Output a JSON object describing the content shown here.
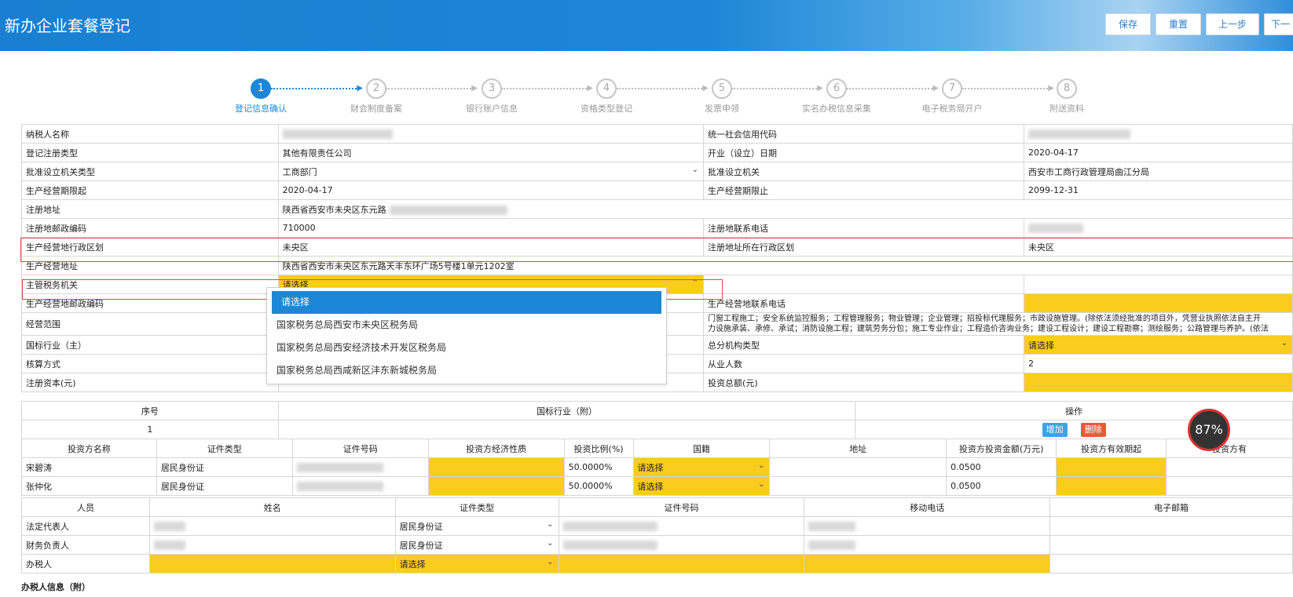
{
  "header": {
    "title": "新办企业套餐登记",
    "buttons": [
      "保存",
      "重置",
      "上一步",
      "下一"
    ]
  },
  "steps": [
    {
      "num": "1",
      "label": "登记信息确认"
    },
    {
      "num": "2",
      "label": "财会制度备案"
    },
    {
      "num": "3",
      "label": "银行账户信息"
    },
    {
      "num": "4",
      "label": "资格类型登记"
    },
    {
      "num": "5",
      "label": "发票申领"
    },
    {
      "num": "6",
      "label": "实名办税信息采集"
    },
    {
      "num": "7",
      "label": "电子税务局开户"
    },
    {
      "num": "8",
      "label": "附送资料"
    }
  ],
  "form": {
    "taxpayer_name": "纳税人名称",
    "credit_code": "统一社会信用代码",
    "reg_type": "登记注册类型",
    "reg_type_val": "其他有限责任公司",
    "open_date": "开业（设立）日期",
    "open_date_val": "2020-04-17",
    "approve_type": "批准设立机关类型",
    "approve_type_val": "工商部门",
    "approve_org": "批准设立机关",
    "approve_org_val": "西安市工商行政管理局曲江分局",
    "period_start": "生产经营期限起",
    "period_start_val": "2020-04-17",
    "period_end": "生产经营期限止",
    "period_end_val": "2099-12-31",
    "reg_addr": "注册地址",
    "reg_addr_val": "陕西省西安市未央区东元路",
    "reg_zip": "注册地邮政编码",
    "reg_zip_val": "710000",
    "reg_phone": "注册地联系电话",
    "biz_district": "生产经营地行政区划",
    "biz_district_val": "未央区",
    "reg_district": "注册地址所在行政区划",
    "reg_district_val": "未央区",
    "biz_addr": "生产经营地址",
    "biz_addr_val": "陕西省西安市未央区东元路天丰东环广场5号楼1单元1202室",
    "tax_org": "主管税务机关",
    "tax_org_val": "请选择",
    "biz_zip": "生产经营地邮政编码",
    "biz_phone": "生产经营地联系电话",
    "scope": "经营范围",
    "scope_val1": "门窗工程施工；安全系统监控服务；工程管理服务；物业管理；企业管理；招投标代理服务；市政设施管理。(除依法须经批准的项目外，凭营业执照依法自主开",
    "scope_val2": "力设施承装、承修、承试；消防设施工程；建筑劳务分包；施工专业作业；工程造价咨询业务；建设工程设计；建设工程勘察；测绘服务；公路管理与养护。(依法",
    "industry": "国标行业（主）",
    "branch_type": "总分机构类型",
    "branch_type_val": "请选择",
    "accounting": "核算方式",
    "employees": "从业人数",
    "employees_val": "2",
    "capital": "注册资本(元)",
    "invest_total": "投资总额(元)"
  },
  "dropdown": [
    "请选择",
    "国家税务总局西安市未央区税务局",
    "国家税务总局西安经济技术开发区税务局",
    "国家税务总局西咸新区沣东新城税务局"
  ],
  "industry_table": {
    "headers": [
      "序号",
      "国标行业（附）",
      "操作"
    ],
    "row": [
      "1"
    ],
    "add": "增加",
    "del": "删除"
  },
  "investor_table": {
    "headers": [
      "投资方名称",
      "证件类型",
      "证件号码",
      "投资方经济性质",
      "投资比例(%)",
      "国籍",
      "地址",
      "投资方投资金额(万元)",
      "投资方有效期起",
      "投资方有"
    ],
    "rows": [
      {
        "name": "宋碧涛",
        "idtype": "居民身份证",
        "ratio": "50.0000%",
        "nation": "请选择",
        "amount": "0.0500"
      },
      {
        "name": "张仲化",
        "idtype": "居民身份证",
        "ratio": "50.0000%",
        "nation": "请选择",
        "amount": "0.0500"
      }
    ]
  },
  "person_table": {
    "headers": [
      "人员",
      "姓名",
      "证件类型",
      "证件号码",
      "移动电话",
      "电子邮箱"
    ],
    "rows": [
      {
        "role": "法定代表人",
        "idtype": "居民身份证"
      },
      {
        "role": "财务负责人",
        "idtype": "居民身份证"
      },
      {
        "role": "办税人",
        "idtype": "请选择"
      }
    ]
  },
  "footer_label": "办税人信息（附）",
  "zoom": "87%",
  "colors": {
    "accent": "#1b87d6",
    "required": "#f9cc1e",
    "delete": "#e85b3a",
    "add": "#3ea2e6"
  }
}
